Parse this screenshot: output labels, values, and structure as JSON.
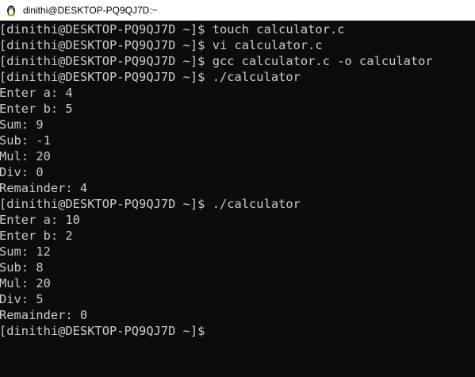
{
  "window": {
    "title": "dinithi@DESKTOP-PQ9QJ7D:~",
    "icon": "linux-penguin-icon"
  },
  "terminal": {
    "background": "#0c0c0c",
    "foreground": "#cccccc",
    "lines": [
      "[dinithi@DESKTOP-PQ9QJ7D ~]$ touch calculator.c",
      "[dinithi@DESKTOP-PQ9QJ7D ~]$ vi calculator.c",
      "[dinithi@DESKTOP-PQ9QJ7D ~]$ gcc calculator.c -o calculator",
      "[dinithi@DESKTOP-PQ9QJ7D ~]$ ./calculator",
      "Enter a: 4",
      "Enter b: 5",
      "Sum: 9",
      "Sub: -1",
      "Mul: 20",
      "Div: 0",
      "Remainder: 4",
      "[dinithi@DESKTOP-PQ9QJ7D ~]$ ./calculator",
      "Enter a: 10",
      "Enter b: 2",
      "Sum: 12",
      "Sub: 8",
      "Mul: 20",
      "Div: 5",
      "Remainder: 0",
      "[dinithi@DESKTOP-PQ9QJ7D ~]$ "
    ]
  }
}
